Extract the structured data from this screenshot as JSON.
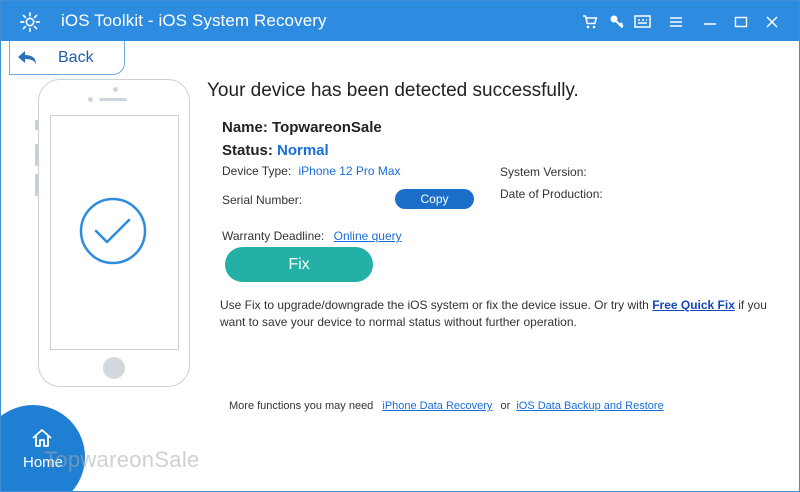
{
  "window": {
    "title": "iOS Toolkit - iOS System Recovery",
    "accent_color": "#2d8be0",
    "toolbar_icons": [
      "cart-icon",
      "key-icon",
      "feedback-icon",
      "menu-icon",
      "minimize-icon",
      "maximize-icon",
      "close-icon"
    ]
  },
  "nav": {
    "back_label": "Back",
    "home_label": "Home"
  },
  "detection": {
    "heading": "Your device has been detected successfully.",
    "name_label": "Name:",
    "name_value": "TopwareonSale",
    "status_label": "Status:",
    "status_value": "Normal",
    "device_type_label": "Device Type:",
    "device_type_value": "iPhone 12 Pro Max",
    "system_version_label": "System Version:",
    "serial_label": "Serial Number:",
    "production_label": "Date of Production:",
    "copy_label": "Copy",
    "warranty_label": "Warranty Deadline:",
    "warranty_link": "Online query",
    "fix_label": "Fix"
  },
  "description": {
    "before": "Use Fix to upgrade/downgrade the iOS system or fix the device issue. Or try with ",
    "quick_fix": "Free Quick Fix",
    "after": " if you want to save your device to normal status without further operation."
  },
  "more": {
    "prefix": "More functions you may need",
    "link1": "iPhone Data Recovery",
    "sep": "or",
    "link2": "iOS Data Backup and Restore"
  },
  "watermark": "TopwareonSale"
}
